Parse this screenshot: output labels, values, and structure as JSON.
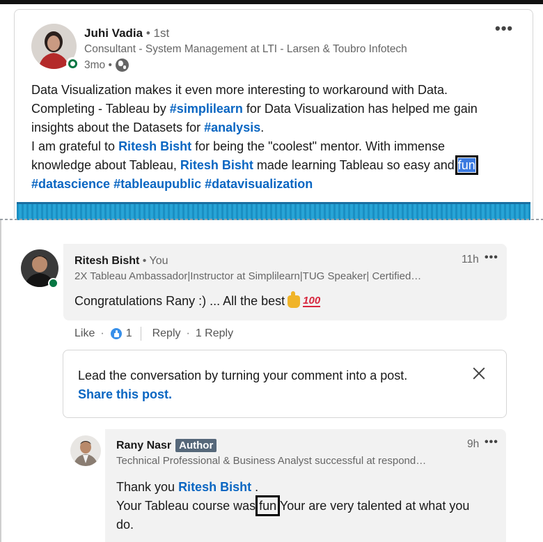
{
  "post": {
    "author_name": "Juhi Vadia",
    "degree": " • 1st",
    "headline": "Consultant - System Management at LTI - Larsen & Toubro Infotech",
    "time": "3mo •",
    "text": {
      "l1": "Data Visualization makes it even more interesting to workaround with Data.",
      "l2_a": "Completing - Tableau by ",
      "l2_tag": "#simplilearn",
      "l2_b": " for Data Visualization has helped me gain",
      "l3_a": "insights about the Datasets for ",
      "l3_tag": "#analysis",
      "l3_b": ".",
      "l4_a": "I am grateful to ",
      "l4_mention": "Ritesh Bisht",
      "l4_b": " for being the \"coolest\" mentor. With immense",
      "l5_a": "knowledge about Tableau, ",
      "l5_mention": "Ritesh Bisht",
      "l5_b": " made learning Tableau so easy and ",
      "l5_sel": "fun",
      "tag1": "#datascience",
      "tag2": "#tableaupublic",
      "tag3": "#datavisualization"
    },
    "more": "•••"
  },
  "comment1": {
    "name": "Ritesh Bisht",
    "you": " • You",
    "headline": "2X Tableau Ambassador|Instructor at Simplilearn|TUG Speaker| Certified…",
    "time": "11h",
    "more": "•••",
    "text": "Congratulations Rany :) ... All the best",
    "hundred": "100"
  },
  "actions": {
    "like": "Like",
    "sep": "·",
    "like_count": "1",
    "reply": "Reply",
    "reply_count": "1 Reply"
  },
  "share_prompt": {
    "text": "Lead the conversation by turning your comment into a post.",
    "link": "Share this post."
  },
  "reply": {
    "name": "Rany Nasr",
    "badge": "Author",
    "headline": "Technical Professional & Business Analyst successful at respond…",
    "time": "9h",
    "more": "•••",
    "l1_a": "Thank you ",
    "l1_mention": "Ritesh Bisht",
    "l1_b": " .",
    "l2_a": "Your Tableau course was ",
    "l2_box": "fun",
    "l2_b": " Your are very talented at what you",
    "l3": "do."
  }
}
